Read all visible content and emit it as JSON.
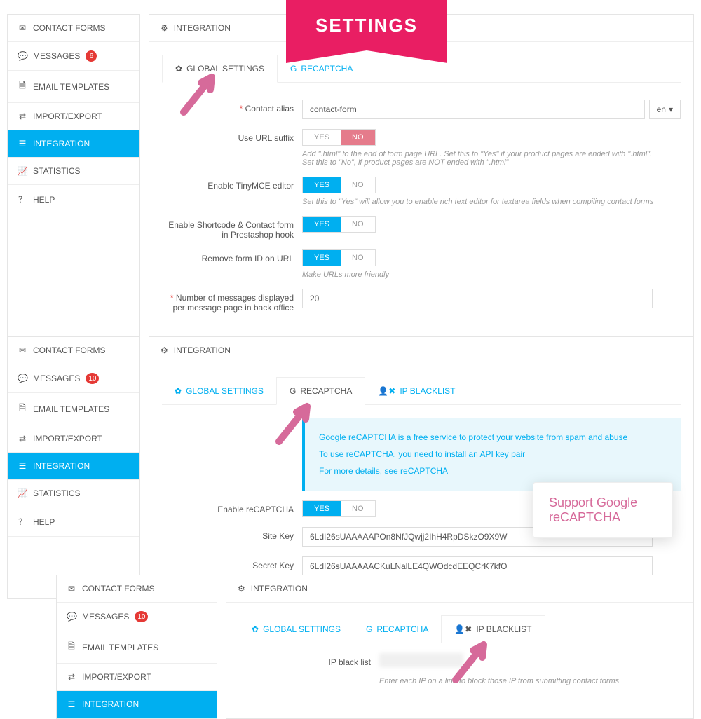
{
  "ribbon": "SETTINGS",
  "sidebar": {
    "items": [
      {
        "label": "CONTACT FORMS"
      },
      {
        "label": "MESSAGES"
      },
      {
        "label": "EMAIL TEMPLATES"
      },
      {
        "label": "IMPORT/EXPORT"
      },
      {
        "label": "INTEGRATION"
      },
      {
        "label": "STATISTICS"
      },
      {
        "label": "HELP"
      }
    ],
    "badge1": "6",
    "badge2": "10",
    "badge3": "10"
  },
  "panel": {
    "title": "INTEGRATION"
  },
  "tabs": {
    "global": "GLOBAL SETTINGS",
    "recaptcha": "RECAPTCHA",
    "ipblacklist": "IP BLACKLIST"
  },
  "shot1": {
    "contact_alias_label": "Contact alias",
    "contact_alias_value": "contact-form",
    "lang": "en",
    "url_suffix_label": "Use URL suffix",
    "url_suffix_help": "Add \".html\" to the end of form page URL. Set this to \"Yes\" if your product pages are ended with \".html\". Set this to \"No\", if product pages are NOT ended with \".html\"",
    "tinymce_label": "Enable TinyMCE editor",
    "tinymce_help": "Set this to \"Yes\" will allow you to enable rich text editor for textarea fields when compiling contact forms",
    "shortcode_label": "Enable Shortcode & Contact form in Prestashop hook",
    "removeid_label": "Remove form ID on URL",
    "removeid_help": "Make URLs more friendly",
    "msgcount_label": "Number of messages displayed per message page in back office",
    "msgcount_value": "20"
  },
  "shot2": {
    "info1": "Google reCAPTCHA is a free service to protect your website from spam and abuse",
    "info2": "To use reCAPTCHA, you need to install an API key pair",
    "info3": "For more details, see reCAPTCHA",
    "enable_label": "Enable reCAPTCHA",
    "sitekey_label": "Site Key",
    "sitekey_val": "6LdI26sUAAAAAPOn8NfJQwjj2IhH4RpDSkzO9X9W",
    "secret_label": "Secret Key",
    "secret_val": "6LdI26sUAAAAACKuLNalLE4QWOdcdEEQCrK7kfO",
    "callout": "Support Google reCAPTCHA"
  },
  "shot3": {
    "ipbl_label": "IP black list",
    "ipbl_help": "Enter each IP on a line to block those IP from submitting contact forms"
  },
  "toggle": {
    "yes": "YES",
    "no": "NO"
  }
}
